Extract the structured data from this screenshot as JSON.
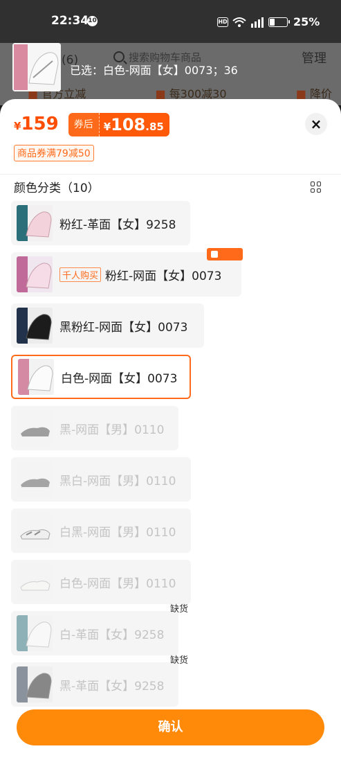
{
  "status_bar": {
    "time": "22:34",
    "notification": "10",
    "hd": "HD",
    "battery_pct": "25%",
    "battery_level": 0.25
  },
  "background": {
    "cart_title": "车(6)",
    "search_placeholder": "搜索购物车商品",
    "manage": "管理",
    "tags": [
      "官方立减",
      "每300减30",
      "降价"
    ]
  },
  "selected_text": "已选：白色-网面【女】0073；36",
  "sheet": {
    "price": "159",
    "currency": "¥",
    "after_coupon_label": "券后",
    "after_coupon_int": "108",
    "after_coupon_dec": ".85",
    "coupon_tag": "商品券满79减50",
    "close": "×",
    "section_title": "颜色分类（10）",
    "options": [
      {
        "name": "粉红-革面【女】9258",
        "state": "normal"
      },
      {
        "name": "粉红-网面【女】0073",
        "badge": "千人购买",
        "state": "normal"
      },
      {
        "name": "黑粉红-网面【女】0073",
        "state": "normal"
      },
      {
        "name": "白色-网面【女】0073",
        "state": "selected"
      },
      {
        "name": "黑-网面【男】0110",
        "state": "disabled"
      },
      {
        "name": "黑白-网面【男】0110",
        "state": "disabled"
      },
      {
        "name": "白黑-网面【男】0110",
        "state": "disabled"
      },
      {
        "name": "白色-网面【男】0110",
        "state": "disabled"
      },
      {
        "name": "白-革面【女】9258",
        "state": "disabled",
        "stock": "缺货"
      },
      {
        "name": "黑-革面【女】9258",
        "state": "disabled",
        "stock": "缺货"
      }
    ],
    "confirm": "确认"
  }
}
